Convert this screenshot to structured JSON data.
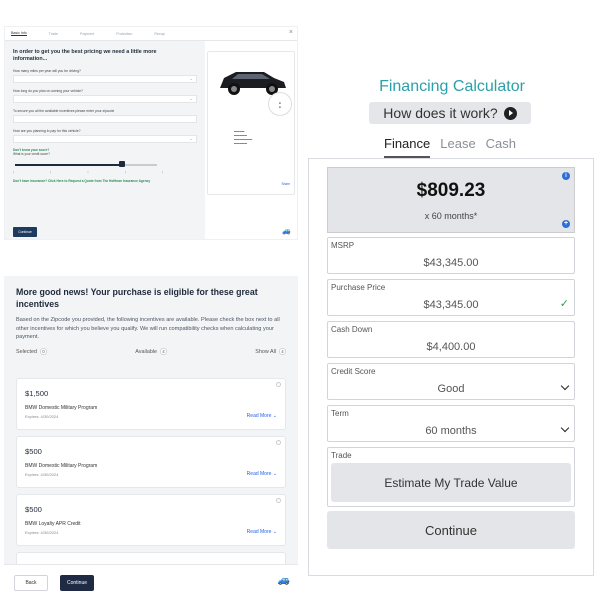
{
  "wizard": {
    "steps": [
      "Basic Info",
      "Trade",
      "Payment",
      "Protection",
      "Recap"
    ],
    "title": "In order to get you the best pricing we need a little more information...",
    "questions": [
      "How many miles per year will you be driving?",
      "How long do you plan on owning your vehicle?",
      "To secure you all the available incentives please enter your zipcode",
      "How are you planning to pay for this vehicle?"
    ],
    "credit_link": "Don't know your score?",
    "credit_question": "What is your credit score?",
    "insurance_link": "Don't have insurance? Click Here to Request a Quote from The Hoffman Insurance Agency",
    "continue_label": "Continue",
    "share_label": "Share",
    "slider_level": 0.75
  },
  "incentives": {
    "title": "More good news! Your purchase is eligible for these great incentives",
    "text": "Based on the Zipcode you provided, the following incentives are available. Please check the box next to all other incentives for which you believe you qualify. We will run compatibility checks when calculating your payment.",
    "selected_label": "Selected",
    "selected_count": "0",
    "available_label": "Available",
    "available_count": "4",
    "showall_label": "Show All",
    "showall_count": "4",
    "items": [
      {
        "amount": "$1,500",
        "name": "BMW Domestic Military Program",
        "expires": "Expires: 4/30/2024",
        "more": "Read More"
      },
      {
        "amount": "$500",
        "name": "BMW Domestic Military Program",
        "expires": "Expires: 4/30/2024",
        "more": "Read More"
      },
      {
        "amount": "$500",
        "name": "BMW Loyalty APR Credit",
        "expires": "Expires: 4/30/2024",
        "more": "Read More"
      }
    ],
    "back_label": "Back",
    "continue_label": "Continue"
  },
  "calculator": {
    "title": "Financing Calculator",
    "how_label": "How does it work?",
    "tabs": [
      "Finance",
      "Lease",
      "Cash"
    ],
    "total": "$809.23",
    "term_text": "x 60 months*",
    "fields": [
      {
        "label": "MSRP",
        "value": "$43,345.00"
      },
      {
        "label": "Purchase Price",
        "value": "$43,345.00"
      },
      {
        "label": "Cash Down",
        "value": "$4,400.00"
      },
      {
        "label": "Credit Score",
        "value": "Good"
      },
      {
        "label": "Term",
        "value": "60 months"
      }
    ],
    "trade_label": "Trade",
    "trade_button": "Estimate My Trade Value",
    "continue_label": "Continue",
    "accent_color": "#2aa0a8"
  }
}
